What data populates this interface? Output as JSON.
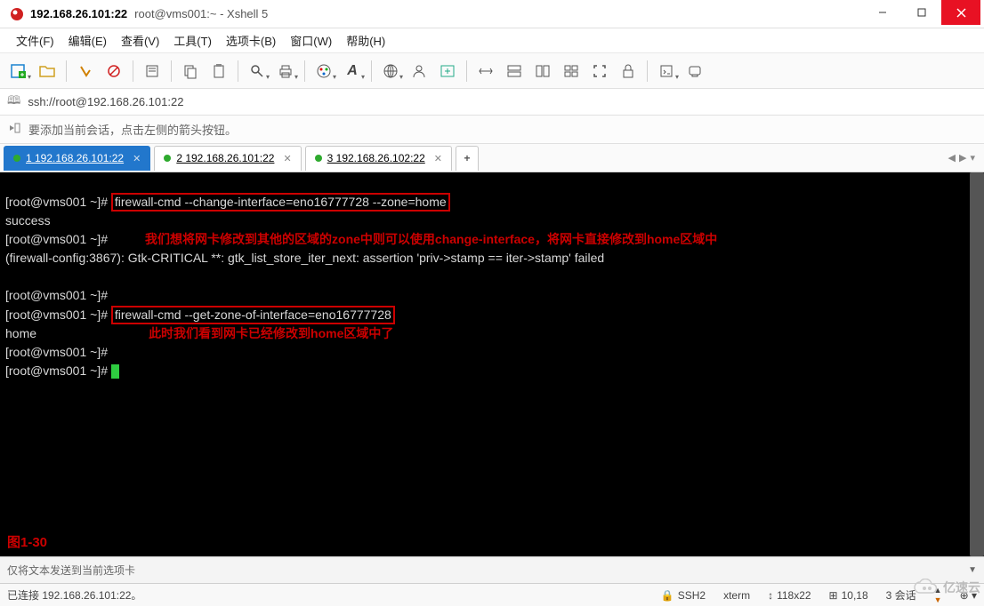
{
  "window": {
    "title": "192.168.26.101:22",
    "subtitle": "root@vms001:~ - Xshell 5"
  },
  "menu": {
    "file": "文件(F)",
    "edit": "编辑(E)",
    "view": "查看(V)",
    "tools": "工具(T)",
    "tabs": "选项卡(B)",
    "window": "窗口(W)",
    "help": "帮助(H)"
  },
  "address": {
    "url": "ssh://root@192.168.26.101:22"
  },
  "hint": {
    "text": "要添加当前会话，点击左侧的箭头按钮。"
  },
  "tabs": [
    {
      "label": "1 192.168.26.101:22",
      "active": true
    },
    {
      "label": "2 192.168.26.101:22",
      "active": false
    },
    {
      "label": "3 192.168.26.102:22",
      "active": false
    }
  ],
  "term": {
    "p1": "[root@vms001 ~]# ",
    "cmd1": "firewall-cmd --change-interface=eno16777728 --zone=home",
    "out1": "success",
    "anno1": "我们想将网卡修改到其他的区域的zone中则可以使用change-interface，将网卡直接修改到home区域中",
    "p2": "[root@vms001 ~]#",
    "err": "(firewall-config:3867): Gtk-CRITICAL **: gtk_list_store_iter_next: assertion 'priv->stamp == iter->stamp' failed",
    "blank": "",
    "p3": "[root@vms001 ~]#",
    "p4": "[root@vms001 ~]# ",
    "cmd2": "firewall-cmd --get-zone-of-interface=eno16777728",
    "out2": "home",
    "anno2": "此时我们看到网卡已经修改到home区域中了",
    "p5": "[root@vms001 ~]#",
    "p6": "[root@vms001 ~]# ",
    "figure": "图1-30"
  },
  "sendbar": {
    "placeholder": "仅将文本发送到当前选项卡"
  },
  "status": {
    "conn": "已连接 192.168.26.101:22。",
    "proto": "SSH2",
    "term": "xterm",
    "size": "118x22",
    "pos": "10,18",
    "sessions": "3 会话"
  },
  "watermark": "亿速云"
}
